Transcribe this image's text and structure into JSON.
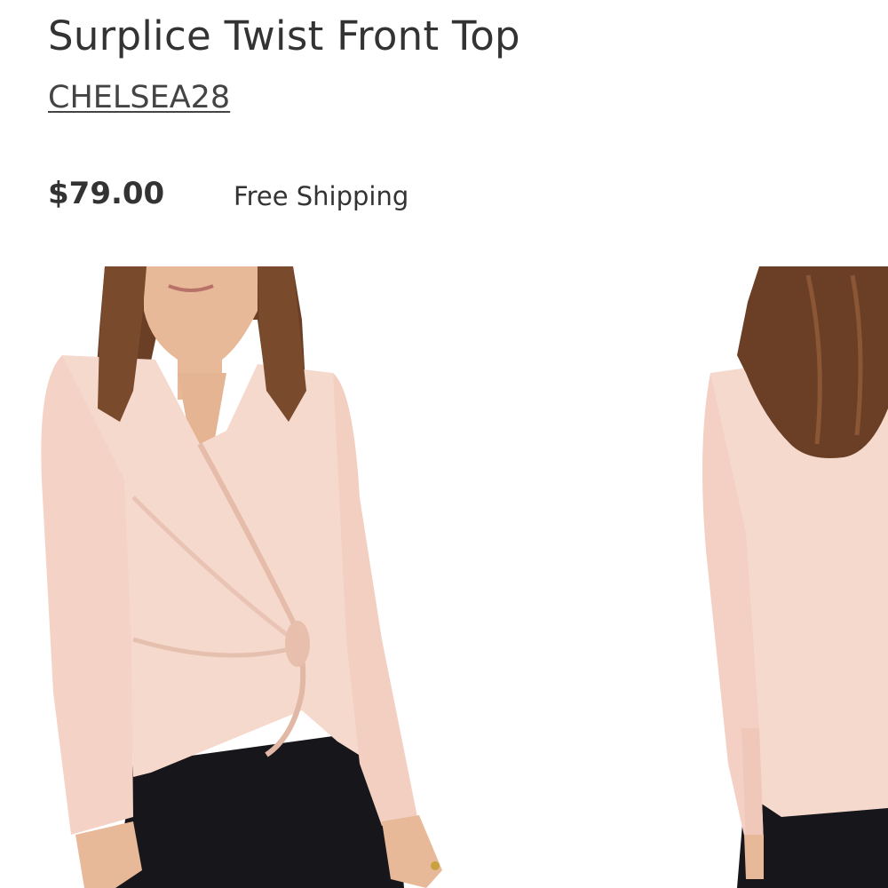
{
  "product": {
    "title": "Surplice Twist Front Top",
    "brand": "CHELSEA28",
    "price": "$79.00",
    "shipping": "Free Shipping"
  },
  "gallery": {
    "images": [
      {
        "name": "front-view"
      },
      {
        "name": "back-view"
      }
    ]
  },
  "colors": {
    "text": "#333333",
    "blouse": "#f6d9cd",
    "blouse_shadow": "#e9c4b5",
    "hair": "#6b3f26",
    "skin": "#e8b998",
    "pants": "#17161a"
  }
}
